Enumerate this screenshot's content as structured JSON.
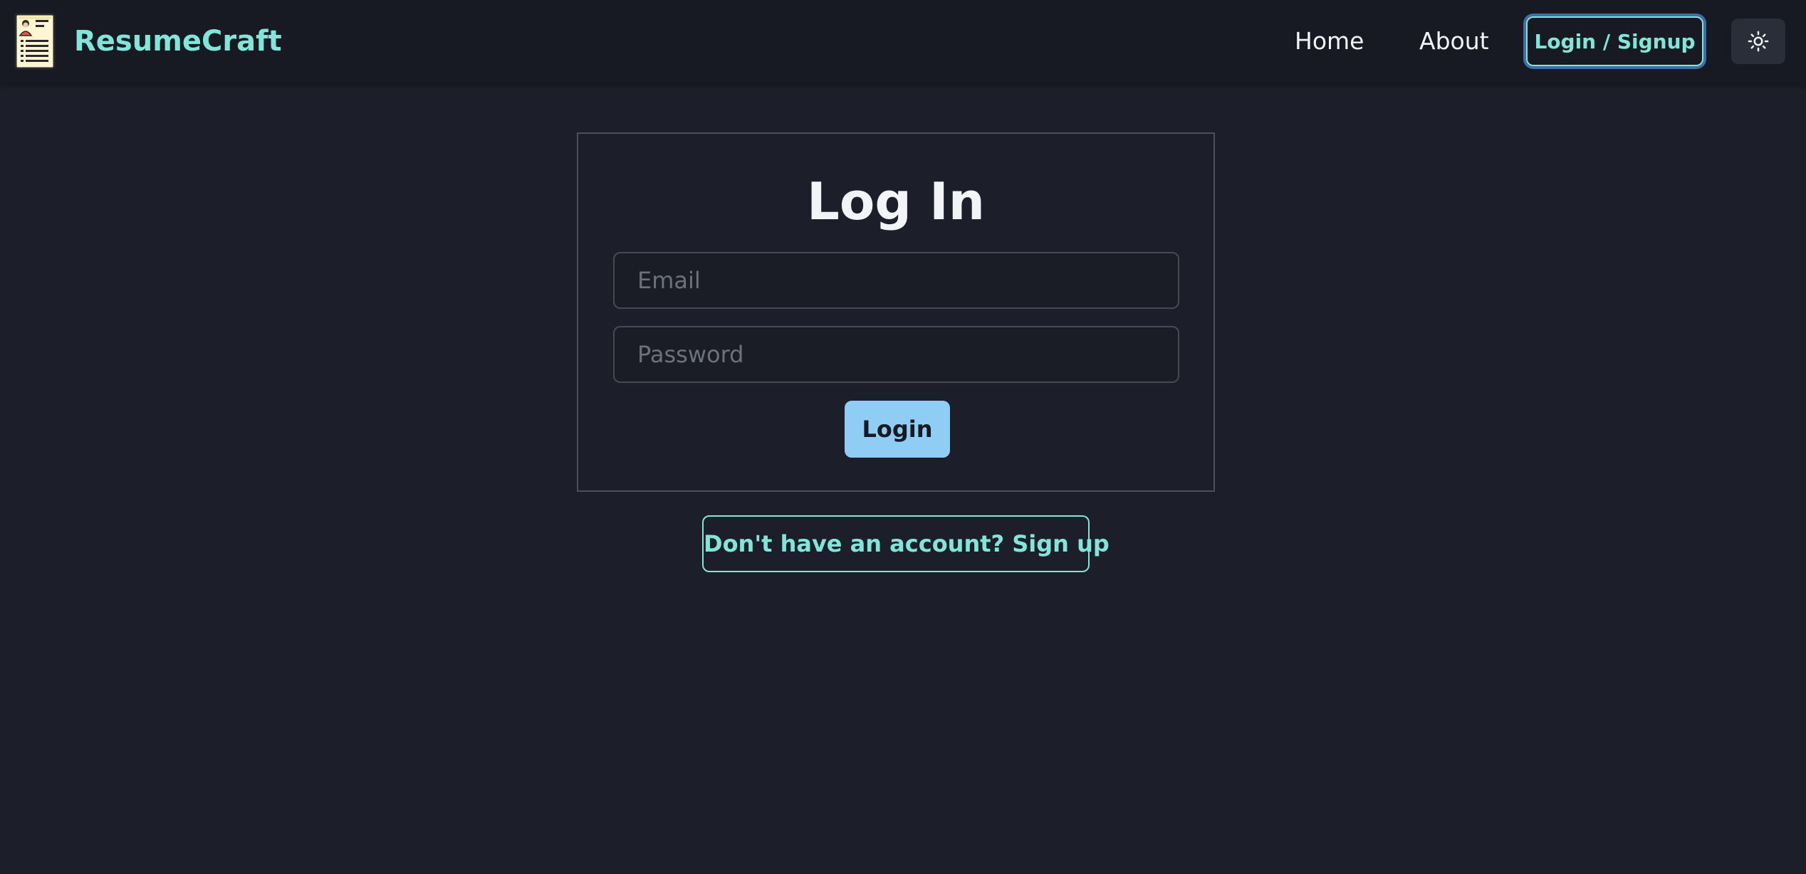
{
  "header": {
    "brand_name": "ResumeCraft",
    "logo_icon": "resume-document-icon",
    "nav_links": [
      {
        "label": "Home"
      },
      {
        "label": "About"
      }
    ],
    "login_signup_label": "Login / Signup",
    "theme_toggle_icon": "sun-icon"
  },
  "login_form": {
    "title": "Log In",
    "email_placeholder": "Email",
    "email_value": "",
    "password_placeholder": "Password",
    "password_value": "",
    "submit_label": "Login"
  },
  "signup_prompt": {
    "label": "Don't have an account? Sign up"
  },
  "colors": {
    "background": "#1c1f29",
    "navbar": "#171a22",
    "accent_teal": "#81e6d9",
    "login_button": "#90cdf4",
    "text_primary": "#f2f4f7"
  }
}
